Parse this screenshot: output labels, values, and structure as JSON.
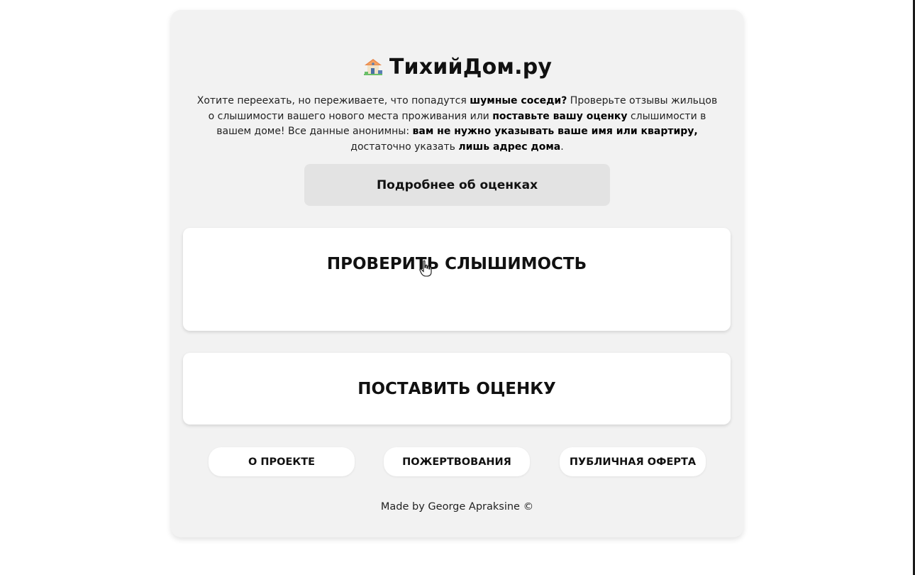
{
  "header": {
    "icon": "house-with-garden-icon",
    "title": "ТихийДом.ру"
  },
  "intro": {
    "p1": "Хотите переехать, но переживаете, что попадутся ",
    "b1": "шумные соседи?",
    "p2": " Проверьте отзывы жильцов о слышимости вашего нового места проживания или ",
    "b2": "поставьте вашу оценку",
    "p3": " слышимости в вашем доме! Все данные анонимны: ",
    "b3": "вам не нужно указывать ваше имя или квартиру,",
    "p4": " достаточно указать ",
    "b4": "лишь адрес дома",
    "p5": "."
  },
  "buttons": {
    "more_label": "Подробнее об оценках",
    "check_label": "ПРОВЕРИТЬ СЛЫШИМОСТЬ",
    "rate_label": "ПОСТАВИТЬ ОЦЕНКУ"
  },
  "footer": {
    "nav": [
      {
        "label": "О ПРОЕКТЕ"
      },
      {
        "label": "ПОЖЕРТВОВАНИЯ"
      },
      {
        "label": "ПУБЛИЧНАЯ ОФЕРТА"
      }
    ],
    "credit": "Made by George Apraksine ©"
  },
  "colors": {
    "card_bg": "#f2f2f2",
    "button_bg": "#ffffff",
    "secondary_button_bg": "#e3e3e3",
    "text": "#111111"
  }
}
